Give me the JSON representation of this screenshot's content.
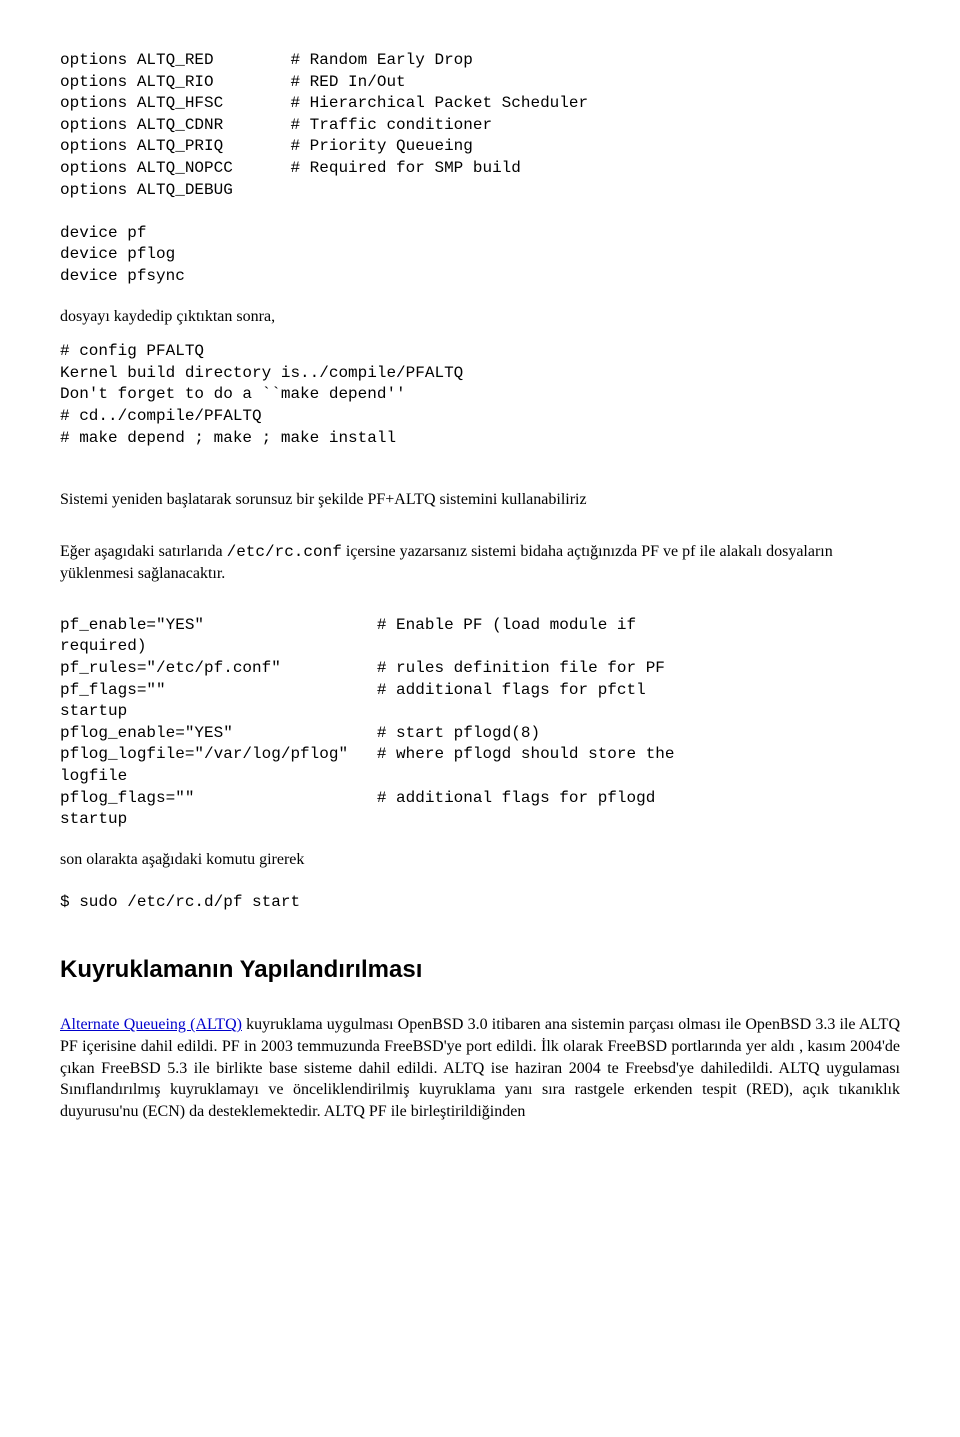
{
  "code1": "options ALTQ_RED        # Random Early Drop\noptions ALTQ_RIO        # RED In/Out\noptions ALTQ_HFSC       # Hierarchical Packet Scheduler\noptions ALTQ_CDNR       # Traffic conditioner\noptions ALTQ_PRIQ       # Priority Queueing\noptions ALTQ_NOPCC      # Required for SMP build\noptions ALTQ_DEBUG\n\ndevice pf\ndevice pflog\ndevice pfsync",
  "code2_intro": "dosyayı kaydedip çıktıktan sonra,",
  "code2": "# config PFALTQ\nKernel build directory is../compile/PFALTQ\nDon't forget to do a ``make depend''\n# cd../compile/PFALTQ\n# make depend ; make ; make install",
  "para_restart": "Sistemi yeniden başlatarak sorunsuz bir şekilde PF+ALTQ sistemini kullanabiliriz",
  "para_rc_pre": "Eğer aşagıdaki satırlarıda ",
  "para_rc_code": "/etc/rc.conf",
  "para_rc_post": "  içersine yazarsanız sistemi bidaha açtığınızda PF  ve pf ile alakalı dosyaların yüklenmesi sağlanacaktır.",
  "code3": "pf_enable=\"YES\"                  # Enable PF (load module if\nrequired)\npf_rules=\"/etc/pf.conf\"          # rules definition file for PF\npf_flags=\"\"                      # additional flags for pfctl\nstartup\npflog_enable=\"YES\"               # start pflogd(8)\npflog_logfile=\"/var/log/pflog\"   # where pflogd should store the\nlogfile\npflog_flags=\"\"                   # additional flags for pflogd\nstartup",
  "para_son": "son olarakta aşağıdaki komutu girerek",
  "code4": "$ sudo /etc/rc.d/pf start",
  "heading": "Kuyruklamanın Yapılandırılması",
  "link_text": "Alternate Queueing (ALTQ)",
  "para_final": "  kuyruklama uygulması OpenBSD 3.0 itibaren ana sistemin parçası olması ile OpenBSD 3.3 ile ALTQ PF içerisine dahil edildi. PF in  2003 temmuzunda FreeBSD'ye port edildi. İlk  olarak FreeBSD portlarında yer aldı , kasım 2004'de çıkan FreeBSD 5.3 ile birlikte base sisteme dahil edildi.  ALTQ ise haziran 2004 te Freebsd'ye dahiledildi. ALTQ uygulaması Sınıflandırılmış kuyruklamayı ve önceliklendirilmiş kuyruklama yanı sıra rastgele erkenden tespit (RED), açık tıkanıklık duyurusu'nu (ECN) da desteklemektedir. ALTQ PF ile birleştirildiğinden"
}
